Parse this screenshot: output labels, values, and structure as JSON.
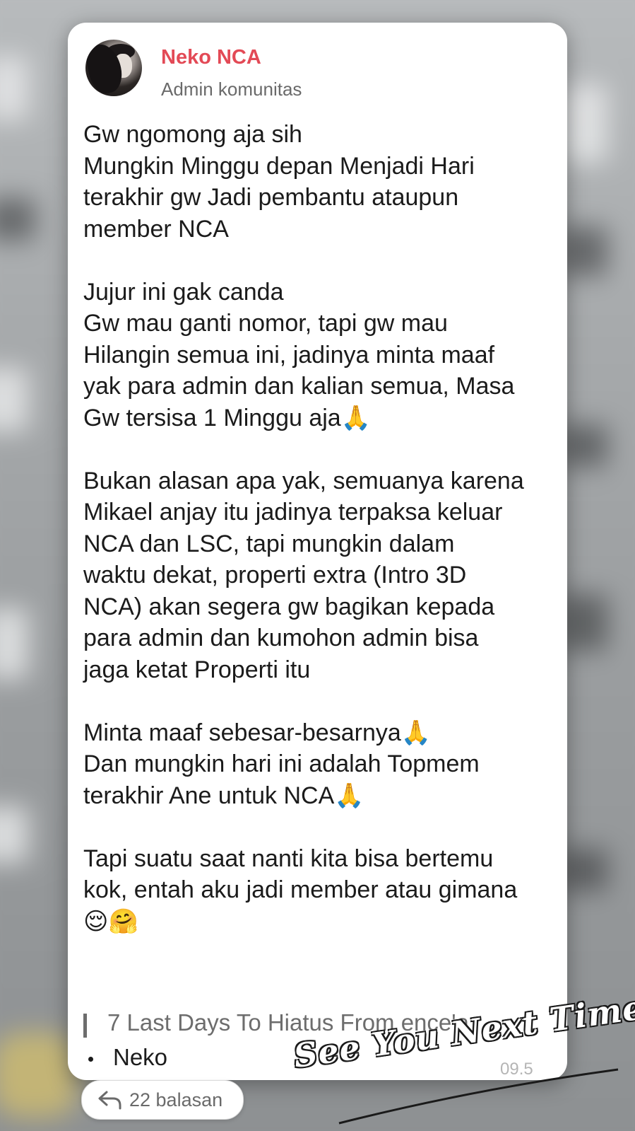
{
  "post": {
    "author_name": "Neko NCA",
    "author_role": "Admin komunitas",
    "message_lines": [
      "Gw ngomong aja sih",
      "Mungkin Minggu depan Menjadi Hari",
      "terakhir gw Jadi pembantu ataupun",
      "member NCA",
      "",
      "Jujur ini gak canda",
      "Gw mau ganti nomor, tapi gw mau",
      "Hilangin semua ini, jadinya minta maaf",
      "yak para admin dan kalian semua, Masa",
      "Gw tersisa 1 Minggu aja🙏",
      "",
      "Bukan alasan apa yak, semuanya karena",
      "Mikael anjay itu jadinya terpaksa keluar",
      "NCA dan LSC, tapi mungkin dalam",
      "waktu dekat, properti extra (Intro 3D",
      "NCA) akan segera gw bagikan kepada",
      "para admin dan kumohon admin bisa",
      "jaga ketat Properti itu",
      "",
      "Minta maaf sebesar-besarnya🙏",
      "Dan mungkin hari ini adalah Topmem",
      "terakhir Ane untuk NCA🙏",
      "",
      "Tapi suatu saat nanti kita bisa bertemu",
      "kok, entah aku jadi member atau gimana",
      "😌🤗"
    ],
    "quote_text": "7 Last Days To Hiatus From ence'a",
    "list_item": "Neko",
    "timestamp_partial": "09.5",
    "reply_label": "22 balasan"
  },
  "overlay": {
    "signature_text": "See You Next Time."
  },
  "colors": {
    "author": "#e34a56",
    "muted": "#6a6a6a",
    "text": "#1b1b1b"
  },
  "icons": {
    "reply": "reply-arrow-icon"
  }
}
